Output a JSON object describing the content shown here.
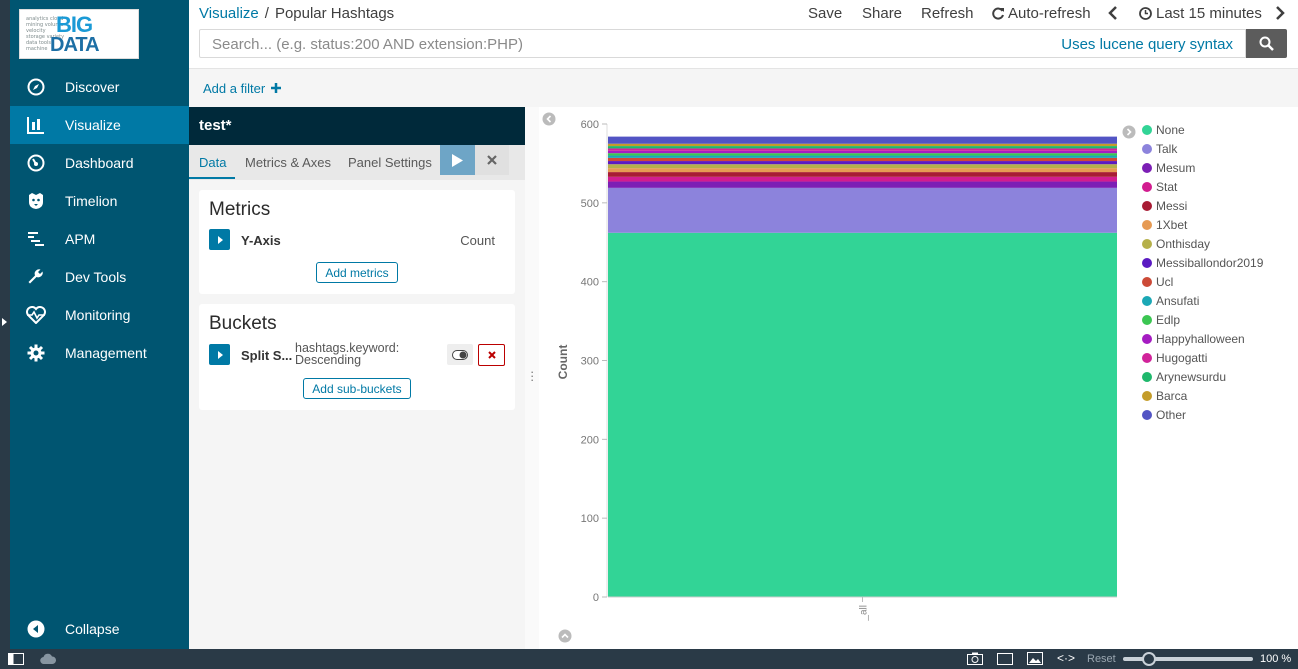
{
  "sidebar": {
    "logo_big": "BIG",
    "logo_data": "DATA",
    "items": [
      {
        "label": "Discover",
        "icon": "compass-icon"
      },
      {
        "label": "Visualize",
        "icon": "bar-chart-icon",
        "active": true
      },
      {
        "label": "Dashboard",
        "icon": "dashboard-icon"
      },
      {
        "label": "Timelion",
        "icon": "timelion-icon"
      },
      {
        "label": "APM",
        "icon": "apm-icon"
      },
      {
        "label": "Dev Tools",
        "icon": "wrench-icon"
      },
      {
        "label": "Monitoring",
        "icon": "heartbeat-icon"
      },
      {
        "label": "Management",
        "icon": "gear-icon"
      }
    ],
    "collapse_label": "Collapse"
  },
  "topbar": {
    "breadcrumb_root": "Visualize",
    "breadcrumb_sep": "/",
    "breadcrumb_current": "Popular Hashtags",
    "save": "Save",
    "share": "Share",
    "refresh": "Refresh",
    "auto_refresh": "Auto-refresh",
    "time_range": "Last 15 minutes"
  },
  "search": {
    "placeholder": "Search... (e.g. status:200 AND extension:PHP)",
    "value": "",
    "syntax_link": "Uses lucene query syntax"
  },
  "filterbar": {
    "add_filter": "Add a filter"
  },
  "editor": {
    "title": "test*",
    "tabs": [
      "Data",
      "Metrics & Axes",
      "Panel Settings"
    ],
    "active_tab": "Data",
    "metrics": {
      "heading": "Metrics",
      "agg_label": "Y-Axis",
      "agg_value": "Count",
      "add_button": "Add metrics"
    },
    "buckets": {
      "heading": "Buckets",
      "agg_label": "Split S...",
      "agg_desc_1": "hashtags.keyword:",
      "agg_desc_2": "Descending",
      "add_button": "Add sub-buckets"
    }
  },
  "chart_data": {
    "type": "bar",
    "stacked": true,
    "categories": [
      "_all"
    ],
    "ylabel": "Count",
    "xlabel": "",
    "ylim": [
      0,
      600
    ],
    "yticks": [
      0,
      100,
      200,
      300,
      400,
      500,
      600
    ],
    "series": [
      {
        "name": "None",
        "values": [
          462
        ],
        "color": "#32d496"
      },
      {
        "name": "Talk",
        "values": [
          57
        ],
        "color": "#8c83dc"
      },
      {
        "name": "Mesum",
        "values": [
          8
        ],
        "color": "#7c1fb5"
      },
      {
        "name": "Stat",
        "values": [
          6
        ],
        "color": "#d21c8f"
      },
      {
        "name": "Messi",
        "values": [
          6
        ],
        "color": "#a81b34"
      },
      {
        "name": "1Xbet",
        "values": [
          5
        ],
        "color": "#e69a53"
      },
      {
        "name": "Onthisday",
        "values": [
          5
        ],
        "color": "#b5b04a"
      },
      {
        "name": "Messiballondor2019",
        "values": [
          4
        ],
        "color": "#5a1ac2"
      },
      {
        "name": "Ucl",
        "values": [
          4
        ],
        "color": "#cc4a37"
      },
      {
        "name": "Ansufati",
        "values": [
          3
        ],
        "color": "#1ba8b5"
      },
      {
        "name": "Edlp",
        "values": [
          3
        ],
        "color": "#3bc652"
      },
      {
        "name": "Happyhalloween",
        "values": [
          3
        ],
        "color": "#a51cc2"
      },
      {
        "name": "Hugogatti",
        "values": [
          3
        ],
        "color": "#d1239a"
      },
      {
        "name": "Arynewsurdu",
        "values": [
          3
        ],
        "color": "#1fb86c"
      },
      {
        "name": "Barca",
        "values": [
          3
        ],
        "color": "#c49c29"
      },
      {
        "name": "Other",
        "values": [
          9
        ],
        "color": "#5254c4"
      }
    ],
    "legend_position": "right"
  },
  "taskbar": {
    "reset": "Reset",
    "zoom": "100 %"
  }
}
